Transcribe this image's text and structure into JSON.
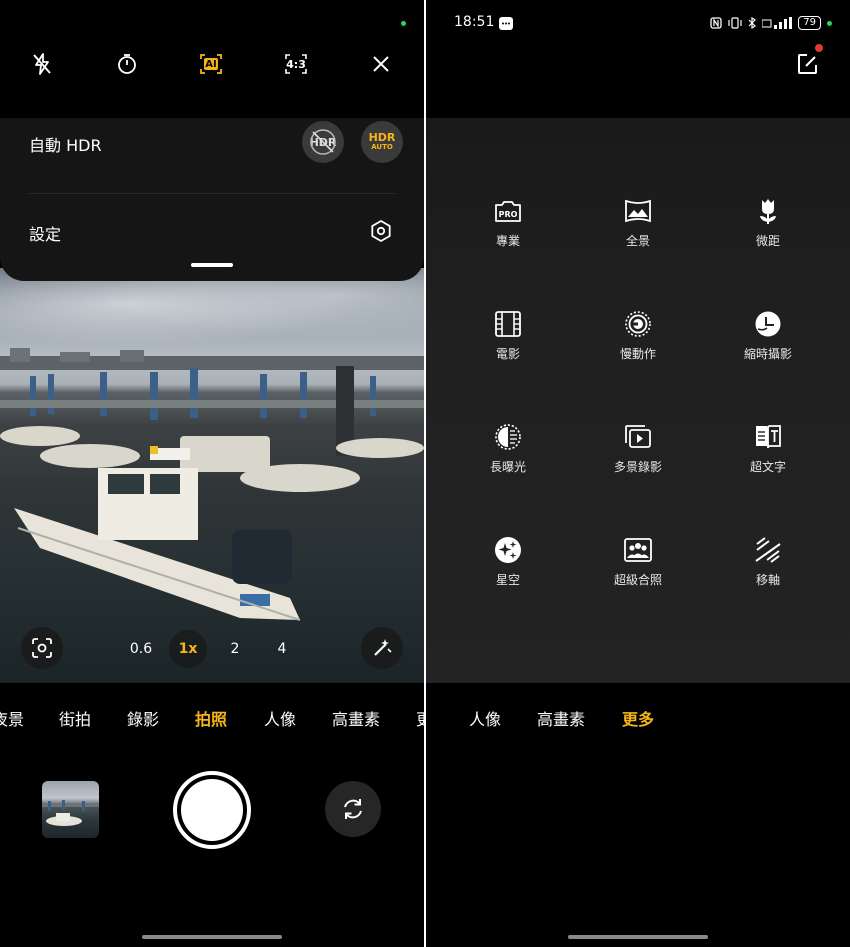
{
  "left": {
    "top_bar": {
      "flash_icon": "flash-off-icon",
      "timer_icon": "timer-icon",
      "ai_label": "AI",
      "ratio_label": "4:3",
      "close_icon": "close-icon"
    },
    "sheet": {
      "hdr_label": "自動 HDR",
      "hdr_off_label": "HDR",
      "hdr_auto_top": "HDR",
      "hdr_auto_bottom": "AUTO",
      "settings_label": "設定"
    },
    "zoom": [
      "0.6",
      "1x",
      "2",
      "4"
    ],
    "zoom_active_index": 1,
    "modes": [
      "夜景",
      "街拍",
      "錄影",
      "拍照",
      "人像",
      "高畫素",
      "更"
    ],
    "active_mode": "拍照"
  },
  "right": {
    "status": {
      "time": "18:51",
      "battery": "79"
    },
    "grid": [
      {
        "label": "專業",
        "icon": "pro-icon"
      },
      {
        "label": "全景",
        "icon": "panorama-icon"
      },
      {
        "label": "微距",
        "icon": "macro-tulip-icon"
      },
      {
        "label": "電影",
        "icon": "film-icon"
      },
      {
        "label": "慢動作",
        "icon": "slow-motion-icon"
      },
      {
        "label": "縮時攝影",
        "icon": "timelapse-icon"
      },
      {
        "label": "長曝光",
        "icon": "long-exposure-icon"
      },
      {
        "label": "多景錄影",
        "icon": "multi-scene-video-icon"
      },
      {
        "label": "超文字",
        "icon": "text-scan-icon"
      },
      {
        "label": "星空",
        "icon": "starry-sky-icon"
      },
      {
        "label": "超級合照",
        "icon": "group-photo-icon"
      },
      {
        "label": "移軸",
        "icon": "tilt-shift-icon"
      }
    ],
    "modes": [
      "人像",
      "高畫素",
      "更多"
    ],
    "active_mode": "更多"
  },
  "colors": {
    "accent": "#f5b518",
    "status_green": "#2fd45a",
    "notify_red": "#e53935"
  }
}
